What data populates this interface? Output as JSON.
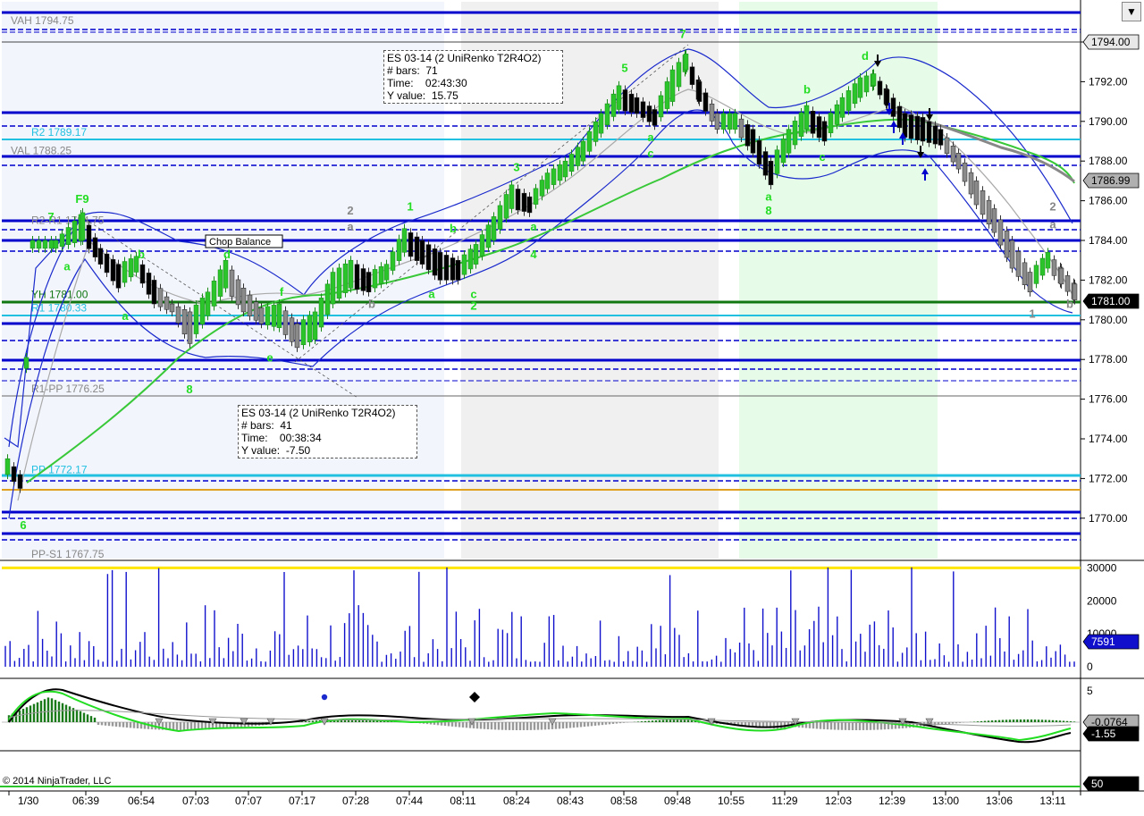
{
  "chart_data": {
    "type": "line",
    "title": "",
    "instrument": "ES 03-14 (2 UniRenko T2R4O2)",
    "ylim": [
      1767.5,
      1795.5
    ],
    "y_ticks": [
      "1794.00",
      "1792.00",
      "1790.00",
      "1788.00",
      "1786.00",
      "1784.00",
      "1782.00",
      "1780.00",
      "1778.00",
      "1776.00",
      "1774.00",
      "1772.00",
      "1770.00"
    ],
    "x_ticks": [
      "1/30",
      "06:39",
      "06:54",
      "07:03",
      "07:07",
      "07:17",
      "07:28",
      "07:44",
      "08:11",
      "08:24",
      "08:43",
      "08:58",
      "09:48",
      "10:55",
      "11:29",
      "12:03",
      "12:39",
      "13:00",
      "13:06",
      "13:11"
    ],
    "price_badges": {
      "top": "1794.00",
      "mid": "1786.99",
      "last": "1781.00"
    },
    "level_labels": [
      {
        "text": "VAH 1794.75",
        "value": 1794.75
      },
      {
        "text": "R2 1789.17",
        "value": 1789.17
      },
      {
        "text": "VAL 1788.25",
        "value": 1788.25
      },
      {
        "text": "R2-R1 1784.75",
        "value": 1784.75
      },
      {
        "text": "YH 1781.00",
        "value": 1781.0
      },
      {
        "text": "R1 1780.33",
        "value": 1780.33
      },
      {
        "text": "R1-PP 1776.25",
        "value": 1776.25
      },
      {
        "text": "PP 1772.17",
        "value": 1772.17
      },
      {
        "text": "PP-S1 1767.75",
        "value": 1767.75
      }
    ],
    "annotation_box": "Chop Balance",
    "tooltips": [
      {
        "title": "ES 03-14 (2 UniRenko T2R4O2)",
        "bars_label": "# bars:",
        "bars": "71",
        "time_label": "Time:",
        "time": "02:43:30",
        "y_label": "Y value:",
        "y": "15.75"
      },
      {
        "title": "ES 03-14 (2 UniRenko T2R4O2)",
        "bars_label": "# bars:",
        "bars": "41",
        "time_label": "Time:",
        "time": "00:38:34",
        "y_label": "Y value:",
        "y": "-7.50"
      }
    ],
    "wave_labels": [
      {
        "text": "F9",
        "x": 92,
        "y": 1785.9
      },
      {
        "text": "7",
        "x": 57,
        "y": 1785.0
      },
      {
        "text": "a",
        "x": 75,
        "y": 1782.5
      },
      {
        "text": "b",
        "x": 158,
        "y": 1783.1
      },
      {
        "text": "a",
        "x": 140,
        "y": 1780.0
      },
      {
        "text": "d",
        "x": 254,
        "y": 1783.1
      },
      {
        "text": "f",
        "x": 315,
        "y": 1781.2
      },
      {
        "text": "e",
        "x": 302,
        "y": 1777.9
      },
      {
        "text": "8",
        "x": 212,
        "y": 1776.3
      },
      {
        "text": "1",
        "x": 459,
        "y": 1785.5
      },
      {
        "text": "b",
        "x": 507,
        "y": 1784.4
      },
      {
        "text": "a",
        "x": 483,
        "y": 1781.1
      },
      {
        "text": "c",
        "x": 530,
        "y": 1781.1
      },
      {
        "text": "2",
        "x": 530,
        "y": 1780.5
      },
      {
        "text": "3",
        "x": 578,
        "y": 1787.5
      },
      {
        "text": "a",
        "x": 597,
        "y": 1784.5
      },
      {
        "text": "4",
        "x": 597,
        "y": 1783.1
      },
      {
        "text": "5",
        "x": 699,
        "y": 1792.5
      },
      {
        "text": "7",
        "x": 764,
        "y": 1794.2
      },
      {
        "text": "a",
        "x": 728,
        "y": 1789.0
      },
      {
        "text": "c",
        "x": 728,
        "y": 1788.2
      },
      {
        "text": "b",
        "x": 903,
        "y": 1791.4
      },
      {
        "text": "c",
        "x": 920,
        "y": 1788.0
      },
      {
        "text": "a",
        "x": 860,
        "y": 1786.0
      },
      {
        "text": "8",
        "x": 860,
        "y": 1785.3
      },
      {
        "text": "d",
        "x": 968,
        "y": 1793.1
      }
    ],
    "gray_labels": [
      {
        "text": "2",
        "x": 392,
        "y": 1785.3
      },
      {
        "text": "a",
        "x": 392,
        "y": 1784.5
      },
      {
        "text": "b",
        "x": 416,
        "y": 1780.6
      },
      {
        "text": "2",
        "x": 1178,
        "y": 1785.5
      },
      {
        "text": "a",
        "x": 1178,
        "y": 1784.6
      },
      {
        "text": "b",
        "x": 1197,
        "y": 1780.6
      },
      {
        "text": "1",
        "x": 1155,
        "y": 1780.1
      }
    ],
    "volume": {
      "ylim": [
        0,
        32000
      ],
      "y_ticks": [
        "30000",
        "20000",
        "10000",
        "0"
      ],
      "last": "7591"
    },
    "oscillator": {
      "y_ticks": [
        "5",
        "-0.0764"
      ],
      "last": "-1.55"
    },
    "bottom_badge": "50",
    "series": []
  },
  "copyright": "© 2014 NinjaTrader, LLC",
  "colors": {
    "bull": "#2bc42b",
    "bear": "#000000",
    "gray": "#8a8a8a",
    "level": "#0000cc",
    "cyan": "#22c0e0",
    "green_level": "#117711",
    "orange": "#e0a020",
    "label_green": "#22dd22"
  }
}
